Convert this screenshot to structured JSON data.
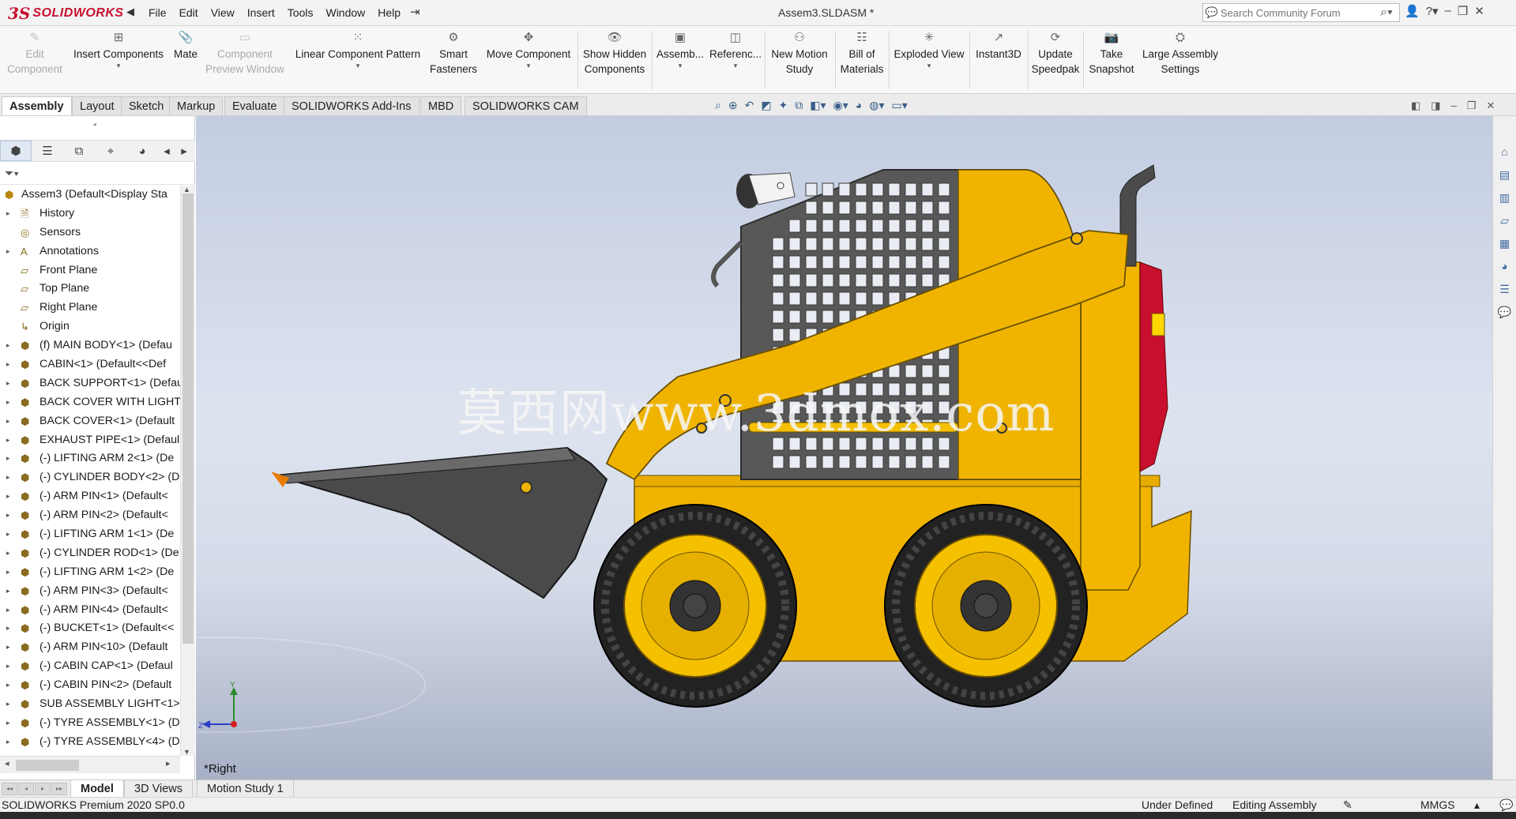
{
  "app": {
    "logo_ds": "3S",
    "logo_brand": "SOLIDWORKS",
    "doc_title": "Assem3.SLDASM *",
    "search_placeholder": "Search Community Forum"
  },
  "menu": [
    "File",
    "Edit",
    "View",
    "Insert",
    "Tools",
    "Window",
    "Help"
  ],
  "commands": [
    {
      "label": "Edit Component",
      "lines": [
        "Edit",
        "Component"
      ],
      "enabled": false,
      "icon": "edit-component-icon"
    },
    {
      "label": "Insert Components",
      "lines": [
        "Insert Components"
      ],
      "enabled": true,
      "icon": "insert-components-icon",
      "dropdown": true
    },
    {
      "label": "Mate",
      "lines": [
        "Mate"
      ],
      "enabled": true,
      "icon": "mate-icon"
    },
    {
      "label": "Component Preview Window",
      "lines": [
        "Component",
        "Preview Window"
      ],
      "enabled": false,
      "icon": "preview-window-icon"
    },
    {
      "label": "Linear Component Pattern",
      "lines": [
        "Linear Component Pattern"
      ],
      "enabled": true,
      "icon": "linear-pattern-icon",
      "dropdown": true
    },
    {
      "label": "Smart Fasteners",
      "lines": [
        "Smart",
        "Fasteners"
      ],
      "enabled": true,
      "icon": "smart-fasteners-icon"
    },
    {
      "label": "Move Component",
      "lines": [
        "Move Component"
      ],
      "enabled": true,
      "icon": "move-component-icon",
      "dropdown": true
    },
    {
      "label": "Show Hidden Components",
      "lines": [
        "Show Hidden",
        "Components"
      ],
      "enabled": true,
      "icon": "show-hidden-icon"
    },
    {
      "label": "Assemb...",
      "lines": [
        "Assemb..."
      ],
      "enabled": true,
      "icon": "assembly-features-icon",
      "dropdown": true
    },
    {
      "label": "Referenc...",
      "lines": [
        "Referenc..."
      ],
      "enabled": true,
      "icon": "reference-geometry-icon",
      "dropdown": true
    },
    {
      "label": "New Motion Study",
      "lines": [
        "New Motion",
        "Study"
      ],
      "enabled": true,
      "icon": "motion-study-icon"
    },
    {
      "label": "Bill of Materials",
      "lines": [
        "Bill of",
        "Materials"
      ],
      "enabled": true,
      "icon": "bom-icon"
    },
    {
      "label": "Exploded View",
      "lines": [
        "Exploded View"
      ],
      "enabled": true,
      "icon": "exploded-view-icon",
      "dropdown": true
    },
    {
      "label": "Instant3D",
      "lines": [
        "Instant3D"
      ],
      "enabled": true,
      "icon": "instant3d-icon"
    },
    {
      "label": "Update Speedpak",
      "lines": [
        "Update",
        "Speedpak"
      ],
      "enabled": true,
      "icon": "speedpak-icon"
    },
    {
      "label": "Take Snapshot",
      "lines": [
        "Take",
        "Snapshot"
      ],
      "enabled": true,
      "icon": "snapshot-icon"
    },
    {
      "label": "Large Assembly Settings",
      "lines": [
        "Large Assembly",
        "Settings"
      ],
      "enabled": true,
      "icon": "large-assembly-icon"
    }
  ],
  "tabs": [
    {
      "label": "Assembly",
      "active": true
    },
    {
      "label": "Layout"
    },
    {
      "label": "Sketch"
    },
    {
      "label": "Markup"
    },
    {
      "label": "Evaluate"
    },
    {
      "label": "SOLIDWORKS Add-Ins"
    },
    {
      "label": "MBD"
    },
    {
      "label": "SOLIDWORKS CAM"
    }
  ],
  "tree": [
    {
      "label": "Assem3  (Default<Display Sta",
      "type": "root"
    },
    {
      "label": "History",
      "type": "folder",
      "expand": true
    },
    {
      "label": "Sensors",
      "type": "sensor"
    },
    {
      "label": "Annotations",
      "type": "annotation",
      "expand": true
    },
    {
      "label": "Front Plane",
      "type": "plane"
    },
    {
      "label": "Top Plane",
      "type": "plane"
    },
    {
      "label": "Right Plane",
      "type": "plane"
    },
    {
      "label": "Origin",
      "type": "origin"
    },
    {
      "label": "(f) MAIN BODY<1> (Defau",
      "type": "part",
      "expand": true
    },
    {
      "label": "CABIN<1> (Default<<Def",
      "type": "part",
      "expand": true
    },
    {
      "label": "BACK SUPPORT<1> (Defau",
      "type": "part",
      "expand": true
    },
    {
      "label": "BACK COVER WITH LIGHT",
      "type": "part",
      "expand": true
    },
    {
      "label": "BACK COVER<1> (Default",
      "type": "part",
      "expand": true
    },
    {
      "label": "EXHAUST PIPE<1> (Defaul",
      "type": "part",
      "expand": true
    },
    {
      "label": "(-) LIFTING ARM 2<1> (De",
      "type": "part",
      "expand": true
    },
    {
      "label": "(-) CYLINDER BODY<2> (D",
      "type": "part",
      "expand": true
    },
    {
      "label": "(-) ARM PIN<1> (Default<",
      "type": "part",
      "expand": true
    },
    {
      "label": "(-) ARM PIN<2> (Default<",
      "type": "part",
      "expand": true
    },
    {
      "label": "(-) LIFTING ARM 1<1> (De",
      "type": "part",
      "expand": true
    },
    {
      "label": "(-) CYLINDER ROD<1> (De",
      "type": "part",
      "expand": true
    },
    {
      "label": "(-) LIFTING ARM 1<2> (De",
      "type": "part",
      "expand": true
    },
    {
      "label": "(-) ARM PIN<3> (Default<",
      "type": "part",
      "expand": true
    },
    {
      "label": "(-) ARM PIN<4> (Default<",
      "type": "part",
      "expand": true
    },
    {
      "label": "(-) BUCKET<1> (Default<<",
      "type": "part",
      "expand": true
    },
    {
      "label": "(-) ARM PIN<10> (Default",
      "type": "part",
      "expand": true
    },
    {
      "label": "(-) CABIN CAP<1> (Defaul",
      "type": "part",
      "expand": true
    },
    {
      "label": "(-) CABIN PIN<2> (Default",
      "type": "part",
      "expand": true
    },
    {
      "label": "SUB ASSEMBLY LIGHT<1>",
      "type": "assembly",
      "expand": true
    },
    {
      "label": "(-) TYRE ASSEMBLY<1> (D",
      "type": "assembly",
      "expand": true
    },
    {
      "label": "(-) TYRE ASSEMBLY<4> (D",
      "type": "assembly",
      "expand": true
    }
  ],
  "viewport": {
    "watermark": "莫西网www.3dmox.com",
    "view_name": "*Right",
    "triad_y": "Y",
    "triad_z": "Z"
  },
  "bottom_tabs": [
    {
      "label": "Model",
      "active": true
    },
    {
      "label": "3D Views"
    },
    {
      "label": "Motion Study 1"
    }
  ],
  "status": {
    "version": "SOLIDWORKS Premium 2020 SP0.0",
    "definition": "Under Defined",
    "mode": "Editing Assembly",
    "units": "MMGS"
  },
  "colors": {
    "machine_yellow": "#f0b400",
    "bucket_gray": "#4a4a4a",
    "cage_gray": "#6e6e6e",
    "light_red": "#c8102e",
    "brand_red": "#c8102e"
  }
}
